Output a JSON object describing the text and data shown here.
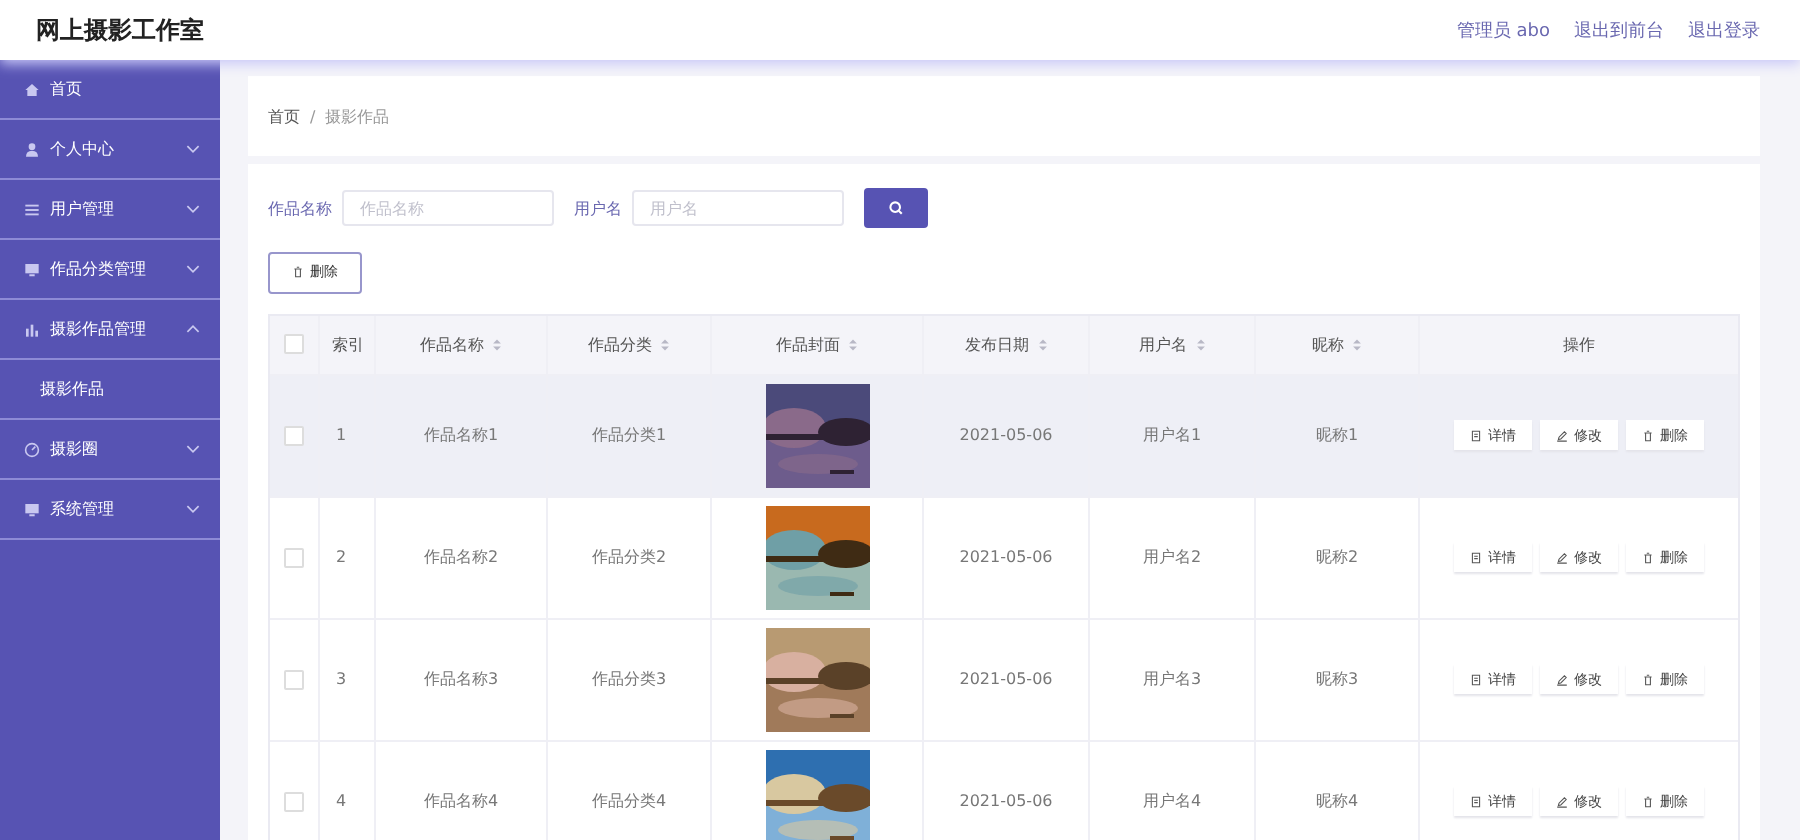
{
  "header": {
    "title": "网上摄影工作室",
    "links": [
      "管理员 abo",
      "退出到前台",
      "退出登录"
    ]
  },
  "sidebar": {
    "items": [
      {
        "label": "首页"
      },
      {
        "label": "个人中心",
        "expanded": false
      },
      {
        "label": "用户管理",
        "expanded": false
      },
      {
        "label": "作品分类管理",
        "expanded": false
      },
      {
        "label": "摄影作品管理",
        "expanded": true,
        "children": [
          {
            "label": "摄影作品"
          }
        ]
      },
      {
        "label": "摄影圈",
        "expanded": false
      },
      {
        "label": "系统管理",
        "expanded": false
      }
    ]
  },
  "breadcrumb": {
    "items": [
      "首页",
      "摄影作品"
    ],
    "separator": "/"
  },
  "search": {
    "fields": [
      {
        "label": "作品名称",
        "placeholder": "作品名称"
      },
      {
        "label": "用户名",
        "placeholder": "用户名"
      }
    ]
  },
  "bulk_delete": "删除",
  "table": {
    "select_all_checked": false,
    "columns": [
      {
        "label": "索引",
        "sortable": false
      },
      {
        "label": "作品名称",
        "sortable": true
      },
      {
        "label": "作品分类",
        "sortable": true
      },
      {
        "label": "作品封面",
        "sortable": true
      },
      {
        "label": "发布日期",
        "sortable": true
      },
      {
        "label": "用户名",
        "sortable": true
      },
      {
        "label": "昵称",
        "sortable": true
      },
      {
        "label": "操作",
        "sortable": false
      }
    ],
    "rows": [
      {
        "index": "1",
        "name": "作品名称1",
        "category": "作品分类1",
        "date": "2021-05-06",
        "user": "用户名1",
        "nickname": "昵称1",
        "highlighted": true,
        "checked": false,
        "actions": [
          {
            "kind": "detail",
            "label": "详情"
          },
          {
            "kind": "edit",
            "label": "修改"
          },
          {
            "kind": "delete",
            "label": "删除"
          }
        ]
      },
      {
        "index": "2",
        "name": "作品名称2",
        "category": "作品分类2",
        "date": "2021-05-06",
        "user": "用户名2",
        "nickname": "昵称2",
        "highlighted": false,
        "checked": false,
        "actions": [
          {
            "kind": "detail",
            "label": "详情"
          },
          {
            "kind": "edit",
            "label": "修改"
          },
          {
            "kind": "delete",
            "label": "删除"
          }
        ]
      },
      {
        "index": "3",
        "name": "作品名称3",
        "category": "作品分类3",
        "date": "2021-05-06",
        "user": "用户名3",
        "nickname": "昵称3",
        "highlighted": false,
        "checked": false,
        "actions": [
          {
            "kind": "detail",
            "label": "详情"
          },
          {
            "kind": "edit",
            "label": "修改"
          },
          {
            "kind": "delete",
            "label": "删除"
          }
        ]
      },
      {
        "index": "4",
        "name": "作品名称4",
        "category": "作品分类4",
        "date": "2021-05-06",
        "user": "用户名4",
        "nickname": "昵称4",
        "highlighted": false,
        "checked": false,
        "actions": [
          {
            "kind": "detail",
            "label": "详情"
          },
          {
            "kind": "edit",
            "label": "修改"
          },
          {
            "kind": "delete",
            "label": "删除"
          }
        ]
      }
    ]
  }
}
